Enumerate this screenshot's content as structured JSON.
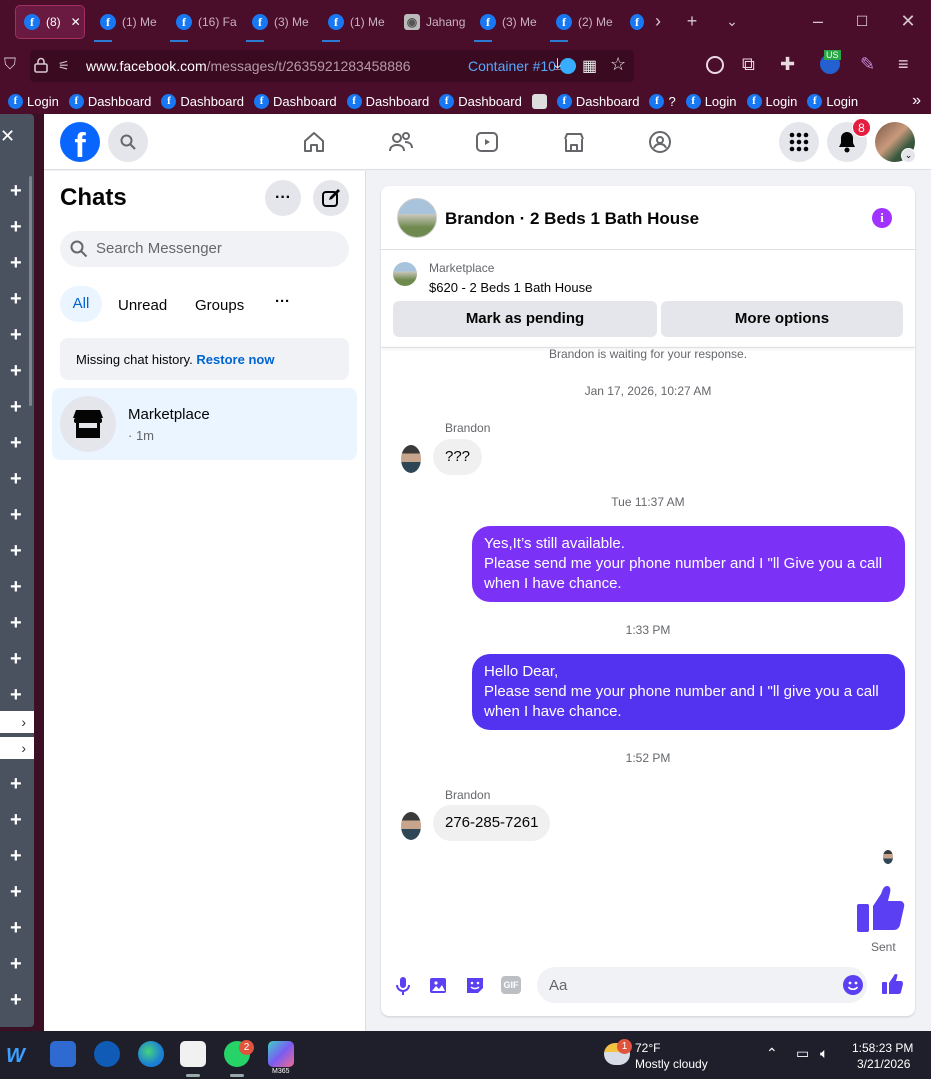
{
  "browser": {
    "tabs": [
      {
        "title": "(8)"
      },
      {
        "title": "(1) Me"
      },
      {
        "title": "(16) Fa"
      },
      {
        "title": "(3) Me"
      },
      {
        "title": "(1) Me"
      },
      {
        "title": "Jahang"
      },
      {
        "title": "(3) Me"
      },
      {
        "title": "(2) Me"
      }
    ],
    "url_prefix": "www.facebook.com",
    "url_path": "/messages/t/2635921283458886",
    "container_label": "Container #10",
    "bookmarks": [
      "Login",
      "Dashboard",
      "Dashboard",
      "Dashboard",
      "Dashboard",
      "Dashboard",
      "Dashboard",
      "?",
      "Login",
      "Login",
      "Login"
    ],
    "us_badge": "US"
  },
  "sidebar": {
    "arrow": "›"
  },
  "facebook": {
    "notif_count": "8",
    "chats_title": "Chats",
    "search_placeholder": "Search Messenger",
    "filters": [
      "All",
      "Unread",
      "Groups"
    ],
    "more_label": "···",
    "missing_history": "Missing chat history.",
    "restore_label": "Restore now",
    "chat_list": [
      {
        "name": "Marketplace",
        "meta": "· 1m"
      }
    ]
  },
  "conversation": {
    "title": "Brandon · 2 Beds 1 Bath House",
    "listing_source": "Marketplace",
    "listing_title": "$620 - 2 Beds 1 Bath House",
    "mark_pending": "Mark as pending",
    "more_options": "More options",
    "waiting": "Brandon is waiting for your response.",
    "ts1": "Jan 17, 2026, 10:27 AM",
    "sender": "Brandon",
    "msg_in_1": "???",
    "ts2": "Tue 11:37 AM",
    "msg_out_1": [
      "Yes,It’s still available.",
      "Please send me your phone number and I \"ll Give you a call",
      "when I have chance."
    ],
    "ts3": "1:33 PM",
    "msg_out_2": [
      "Hello Dear,",
      "Please send me your phone number and I \"ll give you a call",
      "when I have chance."
    ],
    "ts4": "1:52 PM",
    "msg_in_2": "276-285-7261",
    "sent_label": "Sent",
    "composer_placeholder": "Aa",
    "gif_label": "GIF"
  },
  "taskbar": {
    "whatsapp_badge": "2",
    "weather_badge": "1",
    "temperature": "72°F",
    "weather": "Mostly cloudy",
    "time": "1:58:23 PM",
    "date": "3/21/2026",
    "m365_label": "M365"
  },
  "colors": {
    "fb_blue": "#1877f2",
    "bubble_purple": "#7b32f6",
    "bubble_indigo": "#5433f0",
    "like_blue": "#5b3ff2"
  }
}
